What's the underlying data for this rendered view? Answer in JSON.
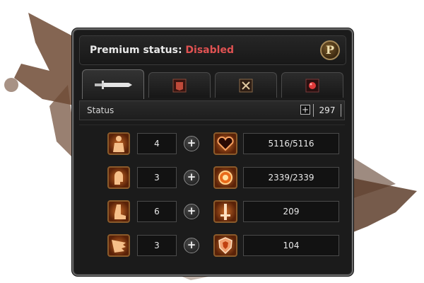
{
  "header": {
    "premium_label": "Premium status:",
    "premium_value": "Disabled",
    "badge_letter": "P"
  },
  "tabs": [
    {
      "icon": "sword-icon",
      "active": true
    },
    {
      "icon": "armor-icon",
      "active": false
    },
    {
      "icon": "crossed-swords-icon",
      "active": false
    },
    {
      "icon": "gem-icon",
      "active": false
    }
  ],
  "status": {
    "label": "Status",
    "plus": "+",
    "points": "297"
  },
  "stats": [
    {
      "icon": "torso-icon",
      "value": "4",
      "plus": "+"
    },
    {
      "icon": "head-icon",
      "value": "3",
      "plus": "+"
    },
    {
      "icon": "foot-icon",
      "value": "6",
      "plus": "+"
    },
    {
      "icon": "wing-icon",
      "value": "3",
      "plus": "+"
    }
  ],
  "attributes": [
    {
      "icon": "heart-icon",
      "value": "5116/5116"
    },
    {
      "icon": "mana-orb-icon",
      "value": "2339/2339"
    },
    {
      "icon": "sword-attack-icon",
      "value": "209"
    },
    {
      "icon": "shield-defense-icon",
      "value": "104"
    }
  ],
  "colors": {
    "disabled": "#e05252",
    "panel": "#1b1b1b",
    "icon_orange": "#c86a28"
  }
}
